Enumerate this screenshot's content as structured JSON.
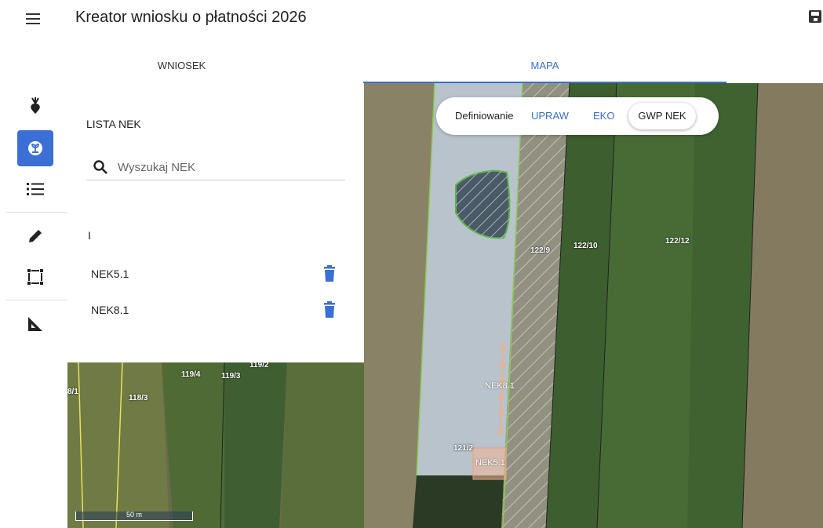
{
  "header": {
    "title": "Kreator wniosku o płatności 2026"
  },
  "tabs": [
    {
      "label": "WNIOSEK",
      "active": false
    },
    {
      "label": "MAPA",
      "active": true
    }
  ],
  "toolbar": {
    "tools": [
      {
        "icon": "beet-icon",
        "active": false
      },
      {
        "icon": "plant-badge-icon",
        "active": true
      },
      {
        "icon": "list-icon",
        "active": false
      },
      {
        "icon": "pencil-icon",
        "active": false
      },
      {
        "icon": "select-rect-icon",
        "active": false
      },
      {
        "icon": "ruler-triangle-icon",
        "active": false
      }
    ],
    "accent": "#3b6fd6"
  },
  "panel": {
    "title": "LISTA NEK",
    "search_placeholder": "Wyszukaj NEK",
    "group_label": "I",
    "items": [
      {
        "label": "NEK5.1"
      },
      {
        "label": "NEK8.1"
      }
    ]
  },
  "mode": {
    "prefix": "Definiowanie",
    "options": [
      "UPRAW",
      "EKO"
    ],
    "selected": "GWP NEK"
  },
  "map": {
    "parcels": [
      "122/9",
      "122/10",
      "122/12",
      "119/2",
      "119/4",
      "119/3",
      "118/3",
      "8/1",
      "121/2"
    ],
    "nek_labels": [
      "NEK8.1",
      "NEK5.1"
    ],
    "scale": "50 m"
  }
}
